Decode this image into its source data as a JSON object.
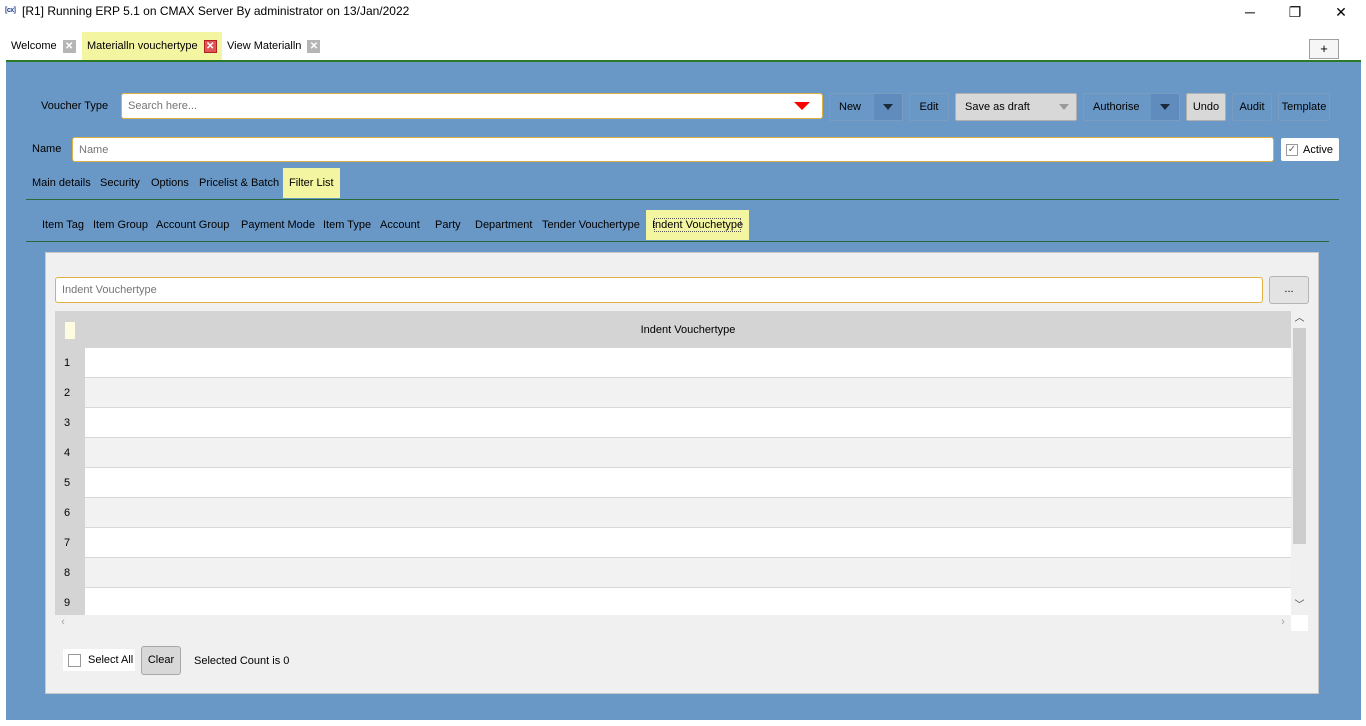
{
  "window": {
    "title": "[R1] Running ERP 5.1 on CMAX Server By administrator on 13/Jan/2022",
    "icon_text": "[cx]",
    "minimize": "─",
    "maximize": "❐",
    "close": "✕"
  },
  "tabs": [
    {
      "label": "Welcome",
      "close": "✕"
    },
    {
      "label": "Materialln vouchertype",
      "close": "✕"
    },
    {
      "label": "View Materialln",
      "close": "✕"
    }
  ],
  "new_tab_button": "+",
  "toolbar": {
    "voucher_type_label": "Voucher Type",
    "search_placeholder": "Search here...",
    "new": "New",
    "edit": "Edit",
    "save_as_draft": "Save as draft",
    "authorise": "Authorise",
    "undo": "Undo",
    "audit": "Audit",
    "template": "Template"
  },
  "name_field": {
    "label": "Name",
    "placeholder": "Name",
    "active_label": "Active",
    "active_checked": true
  },
  "section_tabs": [
    {
      "label": "Main details"
    },
    {
      "label": "Security"
    },
    {
      "label": "Options"
    },
    {
      "label": "Pricelist & Batch"
    },
    {
      "label": "Filter List"
    }
  ],
  "filter_tabs": [
    {
      "label": "Item Tag"
    },
    {
      "label": "Item Group"
    },
    {
      "label": "Account Group"
    },
    {
      "label": "Payment Mode"
    },
    {
      "label": "Item Type"
    },
    {
      "label": "Account"
    },
    {
      "label": "Party"
    },
    {
      "label": "Department"
    },
    {
      "label": "Tender Vouchertype"
    },
    {
      "label": "Indent Vouchetype"
    }
  ],
  "filter_panel": {
    "input_placeholder": "Indent Vouchertype",
    "ellipsis": "...",
    "grid_header": "Indent Vouchertype",
    "rows": [
      "1",
      "2",
      "3",
      "4",
      "5",
      "6",
      "7",
      "8",
      "9"
    ],
    "select_all_label": "Select All",
    "clear_label": "Clear",
    "selected_count_text": "Selected Count is 0"
  },
  "colors": {
    "panel_bg": "#6a98c6",
    "active_tab": "#f4f5a0",
    "input_border": "#e0b040",
    "accent_line": "#2a7a2a",
    "close_red": "#e05555"
  }
}
